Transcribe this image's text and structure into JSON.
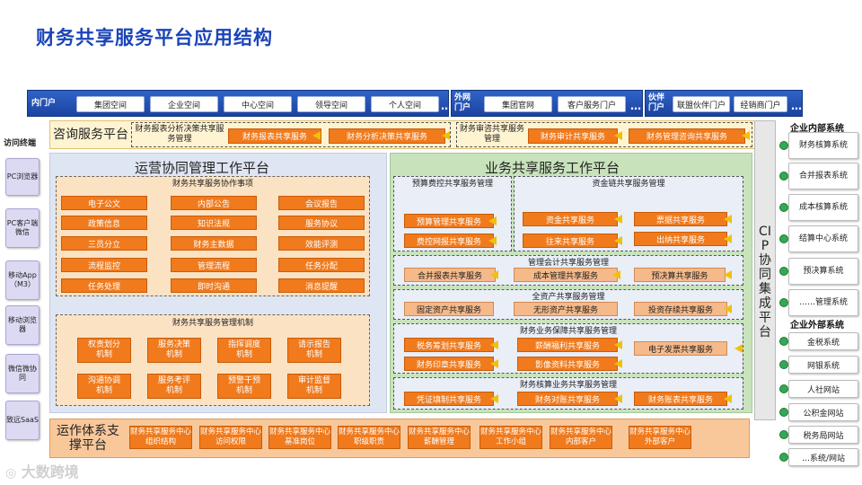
{
  "title": "财务共享服务平台应用结构",
  "portal": {
    "inner_label": "内门户",
    "inner_items": [
      "集团空间",
      "企业空间",
      "中心空间",
      "领导空间",
      "个人空间"
    ],
    "outer_label": "外网门户",
    "outer_items": [
      "集团官网",
      "客户服务门户"
    ],
    "partner_label": "伙伴门户",
    "partner_items": [
      "联盟伙伴门户",
      "经销商门户"
    ],
    "ellipsis": "…"
  },
  "terminals": {
    "title": "访问终端",
    "items": [
      "PC浏览器",
      "PC客户端微信",
      "移动App（M3）",
      "移动浏览器",
      "微信微协同",
      "致远SaaS"
    ]
  },
  "consult": {
    "title": "咨询服务平台",
    "group1_title": "财务报表分析决策共享服务管理",
    "group1_items": [
      "财务报表共享服务",
      "财务分析决策共享服务"
    ],
    "group2_title": "财务审咨共享服务管理",
    "group2_items": [
      "财务审计共享服务",
      "财务管理咨询共享服务"
    ]
  },
  "ops": {
    "title": "运营协同管理工作平台",
    "collab_title": "财务共享服务协作事项",
    "collab_items": [
      "电子公文",
      "内部公告",
      "会议报告",
      "政策信息",
      "知识法规",
      "服务协议",
      "三员分立",
      "财务主数据",
      "效能评测",
      "流程监控",
      "管理流程",
      "任务分配",
      "任务处理",
      "即时沟通",
      "消息提醒"
    ],
    "mech_title": "财务共享服务管理机制",
    "mech_items": [
      "权责划分机制",
      "服务决策机制",
      "指挥调度机制",
      "请示报告机制",
      "沟通协调机制",
      "服务考评机制",
      "预警干预机制",
      "审计监督机制"
    ]
  },
  "biz": {
    "title": "业务共享服务工作平台",
    "budget_title": "预算费控共享服务管理",
    "budget_items": [
      "预算管理共享服务",
      "费控网报共享服务"
    ],
    "fund_title": "资金链共享服务管理",
    "fund_items": [
      "资金共享服务",
      "票据共享服务",
      "往来共享服务",
      "出纳共享服务"
    ],
    "mgmt_acct_title": "管理会计共享服务管理",
    "mgmt_acct_items": [
      "合并报表共享服务",
      "成本管理共享服务",
      "预决算共享服务"
    ],
    "asset_title": "全资产共享服务管理",
    "asset_items": [
      "固定资产共享服务",
      "无形资产共享服务",
      "投资存续共享服务"
    ],
    "guarantee_title": "财务业务保障共享服务管理",
    "guarantee_items": [
      "税务筹划共享服务",
      "薪酬福利共享服务",
      "电子发票共享服务",
      "财务印章共享服务",
      "影像资料共享服务"
    ],
    "core_title": "财务核算业务共享服务管理",
    "core_items": [
      "凭证填制共享服务",
      "财务对账共享服务",
      "财务账表共享服务"
    ]
  },
  "cip": {
    "label": "CIP协同集成平台"
  },
  "right": {
    "inner_title": "企业内部系统",
    "inner_items": [
      "财务核算系统",
      "合并报表系统",
      "成本核算系统",
      "结算中心系统",
      "预决算系统",
      "……管理系统"
    ],
    "outer_title": "企业外部系统",
    "outer_items": [
      "金税系统",
      "网银系统",
      "人社网站",
      "公积金网站",
      "税务局网站",
      "…系统/网站"
    ]
  },
  "support": {
    "title": "运作体系支撑平台",
    "items": [
      "财务共享服务中心组织结构",
      "财务共享服务中心访问权限",
      "财务共享服务中心基准岗位",
      "财务共享服务中心职级职责",
      "财务共享服务中心薪酬管理",
      "财务共享服务中心工作小组",
      "财务共享服务中心内部客户",
      "财务共享服务中心外部客户"
    ]
  },
  "watermark": "大数跨境",
  "colors": {
    "orange": "#f07a1c",
    "portal_blue": "#1f4aa8",
    "title_blue": "#1a44b8",
    "ops_blue": "#dfe6f3",
    "biz_green": "#c8e3bc",
    "support_orange": "#f9c89a"
  }
}
